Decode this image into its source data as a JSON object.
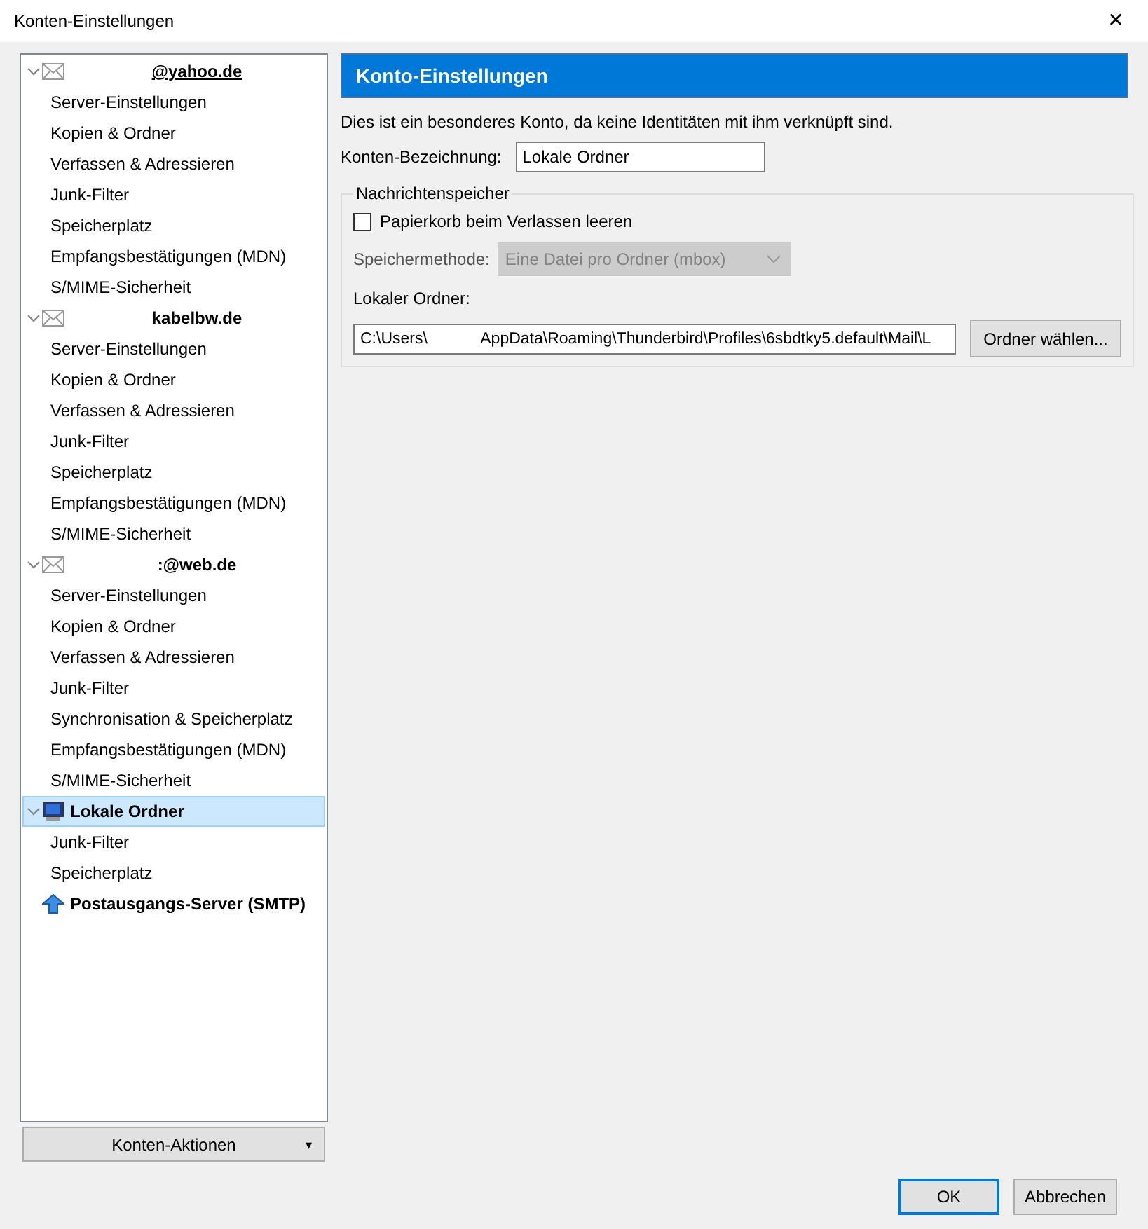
{
  "window": {
    "title": "Konten-Einstellungen",
    "close": "✕"
  },
  "tree": [
    {
      "label": "@yahoo.de",
      "kind": "mail",
      "expanded": true,
      "selected": false,
      "focused": true,
      "children": [
        {
          "label": "Server-Einstellungen"
        },
        {
          "label": "Kopien & Ordner"
        },
        {
          "label": "Verfassen & Adressieren"
        },
        {
          "label": "Junk-Filter"
        },
        {
          "label": "Speicherplatz"
        },
        {
          "label": "Empfangsbestätigungen (MDN)"
        },
        {
          "label": "S/MIME-Sicherheit"
        }
      ]
    },
    {
      "label": "kabelbw.de",
      "kind": "mail",
      "expanded": true,
      "selected": false,
      "focused": false,
      "children": [
        {
          "label": "Server-Einstellungen"
        },
        {
          "label": "Kopien & Ordner"
        },
        {
          "label": "Verfassen & Adressieren"
        },
        {
          "label": "Junk-Filter"
        },
        {
          "label": "Speicherplatz"
        },
        {
          "label": "Empfangsbestätigungen (MDN)"
        },
        {
          "label": "S/MIME-Sicherheit"
        }
      ]
    },
    {
      "label": ":@web.de",
      "kind": "mail",
      "expanded": true,
      "selected": false,
      "focused": false,
      "children": [
        {
          "label": "Server-Einstellungen"
        },
        {
          "label": "Kopien & Ordner"
        },
        {
          "label": "Verfassen & Adressieren"
        },
        {
          "label": "Junk-Filter"
        },
        {
          "label": "Synchronisation & Speicherplatz"
        },
        {
          "label": "Empfangsbestätigungen (MDN)"
        },
        {
          "label": "S/MIME-Sicherheit"
        }
      ]
    },
    {
      "label": "Lokale Ordner",
      "kind": "computer",
      "expanded": true,
      "selected": true,
      "focused": false,
      "children": [
        {
          "label": "Junk-Filter"
        },
        {
          "label": "Speicherplatz"
        }
      ]
    },
    {
      "label": "Postausgangs-Server (SMTP)",
      "kind": "outbox",
      "selected": false,
      "focused": false
    }
  ],
  "account_actions": {
    "label": "Konten-Aktionen",
    "caret": "▾"
  },
  "panel": {
    "header": "Konto-Einstellungen",
    "info": "Dies ist ein besonderes Konto, da keine Identitäten mit ihm verknüpft sind.",
    "name_label": "Konten-Bezeichnung:",
    "name_value": "Lokale Ordner",
    "group": {
      "legend": "Nachrichtenspeicher",
      "checkbox": {
        "label": "Papierkorb beim Verlassen leeren",
        "checked": false
      },
      "method_label": "Speichermethode:",
      "method_value": "Eine Datei pro Ordner (mbox)",
      "method_disabled": true,
      "folder_label": "Lokaler Ordner:",
      "folder_value": "C:\\Users\\            AppData\\Roaming\\Thunderbird\\Profiles\\6sbdtky5.default\\Mail\\L",
      "folder_button": "Ordner wählen..."
    }
  },
  "buttons": [
    {
      "label": "OK",
      "default": true
    },
    {
      "label": "Abbrechen",
      "default": false
    }
  ]
}
